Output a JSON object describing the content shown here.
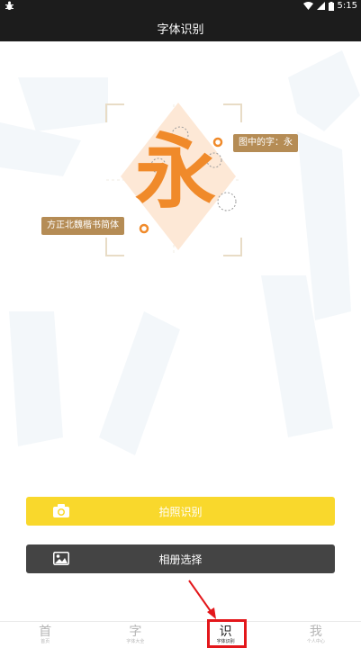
{
  "status_bar": {
    "left_icon": "bug-icon",
    "time": "5:15"
  },
  "header": {
    "title": "字体识别"
  },
  "hero": {
    "recognized_label": "图中的字：永",
    "font_label": "方正北魏楷书简体",
    "character": "永"
  },
  "buttons": {
    "camera_label": "拍照识别",
    "album_label": "相册选择"
  },
  "tabs": [
    {
      "glyph": "首",
      "label": "首页"
    },
    {
      "glyph": "字",
      "label": "字体大全"
    },
    {
      "glyph": "识",
      "label": "字体识别"
    },
    {
      "glyph": "我",
      "label": "个人中心"
    }
  ],
  "colors": {
    "accent": "#f9d82c",
    "tag": "#b58c55",
    "highlight": "#e3171b",
    "char": "#f08a2a"
  }
}
